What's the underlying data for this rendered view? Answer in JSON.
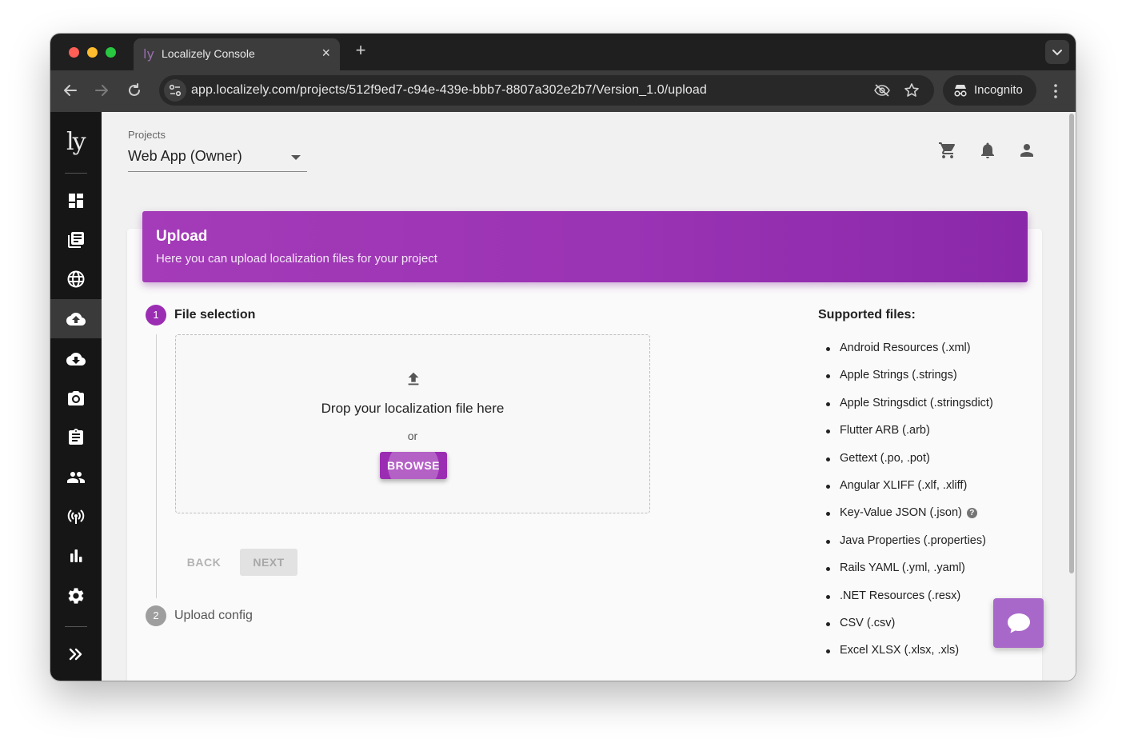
{
  "browser": {
    "tab_title": "Localizely Console",
    "tab_favicon": "ly",
    "url": "app.localizely.com/projects/512f9ed7-c94e-439e-bbb7-8807a302e2b7/Version_1.0/upload",
    "incognito_label": "Incognito"
  },
  "app": {
    "logo": "ly",
    "projects_label": "Projects",
    "project_selected": "Web App (Owner)",
    "accent_color": "#9b2db3",
    "sidebar_items": [
      {
        "icon": "dashboard-icon"
      },
      {
        "icon": "library-books-icon"
      },
      {
        "icon": "globe-icon"
      },
      {
        "icon": "cloud-upload-icon",
        "active": true
      },
      {
        "icon": "cloud-download-icon"
      },
      {
        "icon": "camera-icon"
      },
      {
        "icon": "assignment-icon"
      },
      {
        "icon": "people-icon"
      },
      {
        "icon": "broadcast-icon"
      },
      {
        "icon": "bar-chart-icon"
      },
      {
        "icon": "settings-icon"
      },
      {
        "icon": "expand-sidebar-icon"
      }
    ]
  },
  "upload": {
    "title": "Upload",
    "subtitle": "Here you can upload localization files for your project",
    "step1_number": "1",
    "step1_label": "File selection",
    "drop_text": "Drop your localization file here",
    "or_text": "or",
    "browse_label": "BROWSE",
    "back_label": "BACK",
    "next_label": "NEXT",
    "step2_number": "2",
    "step2_label": "Upload config"
  },
  "supported": {
    "title": "Supported files:",
    "items": [
      "Android Resources (.xml)",
      "Apple Strings (.strings)",
      "Apple Stringsdict (.stringsdict)",
      "Flutter ARB (.arb)",
      "Gettext (.po, .pot)",
      "Angular XLIFF (.xlf, .xliff)",
      "Key-Value JSON (.json)",
      "Java Properties (.properties)",
      "Rails YAML (.yml, .yaml)",
      ".NET Resources (.resx)",
      "CSV (.csv)",
      "Excel XLSX (.xlsx, .xls)"
    ]
  }
}
